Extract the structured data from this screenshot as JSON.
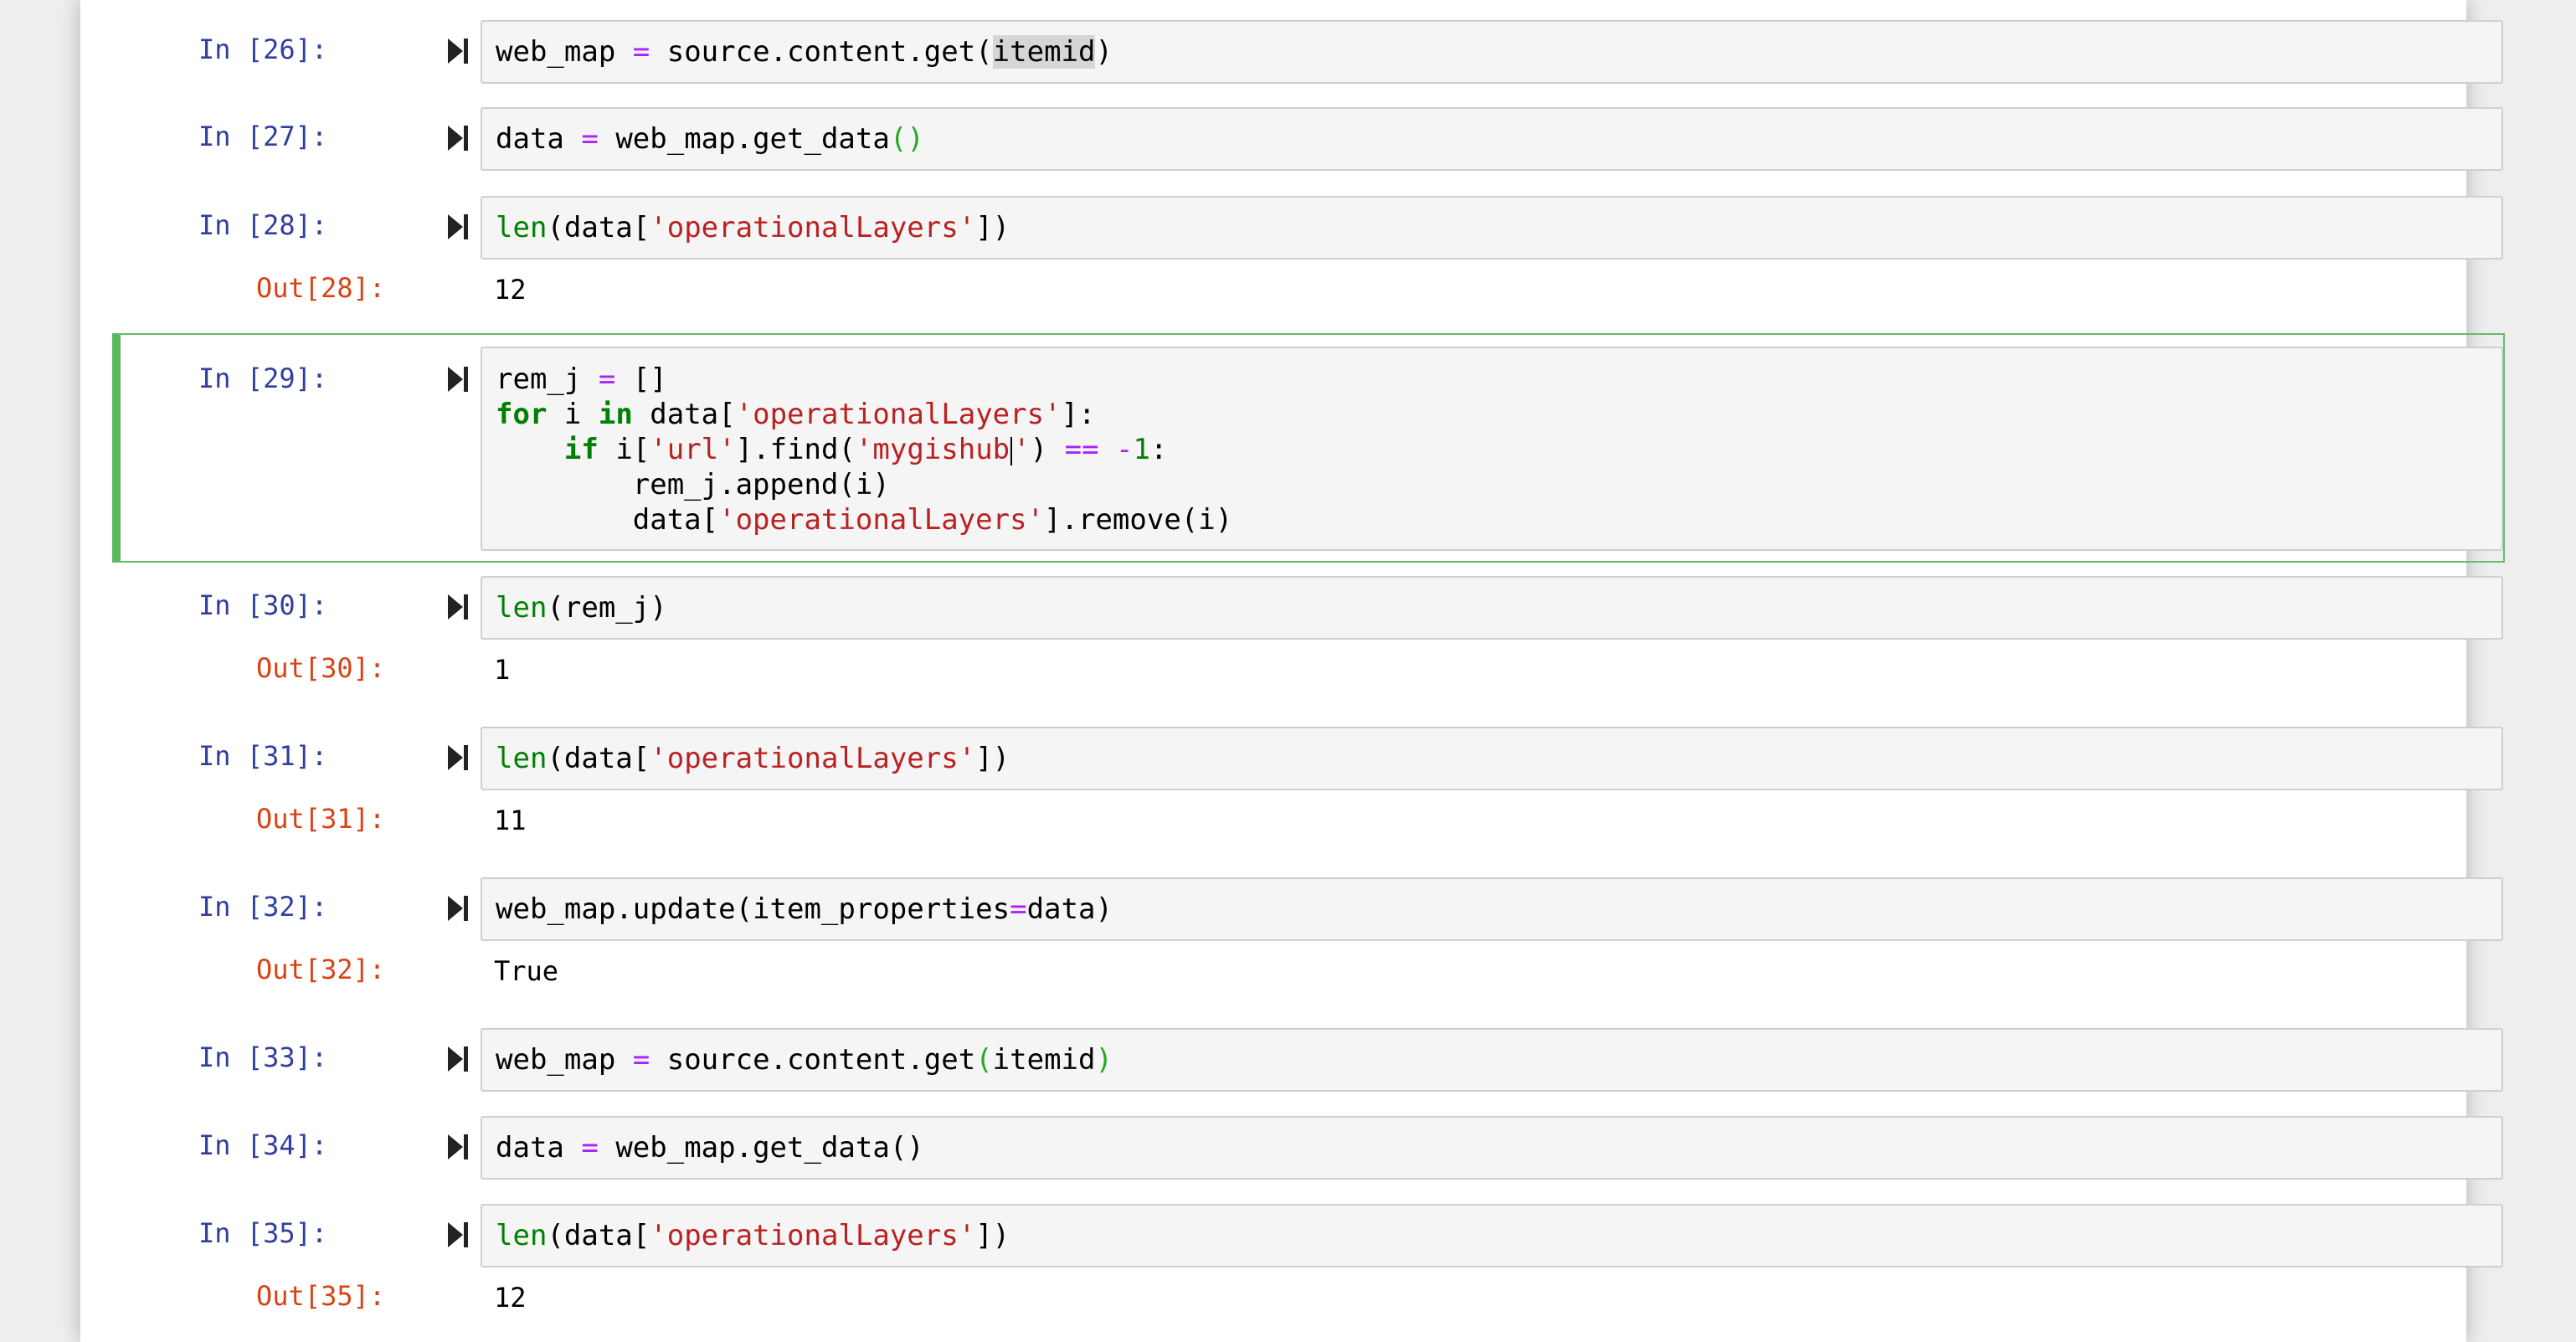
{
  "notebook": {
    "cells": [
      {
        "prompt": "In [26]:",
        "code": "web_map = source.content.get(itemid)",
        "out_prompt": "",
        "output": ""
      },
      {
        "prompt": "In [27]:",
        "code": "data = web_map.get_data()",
        "out_prompt": "",
        "output": ""
      },
      {
        "prompt": "In [28]:",
        "code": "len(data['operationalLayers'])",
        "out_prompt": "Out[28]:",
        "output": "12"
      },
      {
        "prompt": "In [29]:",
        "code_lines": [
          "rem_j = []",
          "for i in data['operationalLayers']:",
          "    if i['url'].find('mygishub') == -1:",
          "        rem_j.append(i)",
          "        data['operationalLayers'].remove(i)"
        ],
        "out_prompt": "",
        "output": ""
      },
      {
        "prompt": "In [30]:",
        "code": "len(rem_j)",
        "out_prompt": "Out[30]:",
        "output": "1"
      },
      {
        "prompt": "In [31]:",
        "code": "len(data['operationalLayers'])",
        "out_prompt": "Out[31]:",
        "output": "11"
      },
      {
        "prompt": "In [32]:",
        "code": "web_map.update(item_properties=data)",
        "out_prompt": "Out[32]:",
        "output": "True"
      },
      {
        "prompt": "In [33]:",
        "code": "web_map = source.content.get(itemid)",
        "out_prompt": "",
        "output": ""
      },
      {
        "prompt": "In [34]:",
        "code": "data = web_map.get_data()",
        "out_prompt": "",
        "output": ""
      },
      {
        "prompt": "In [35]:",
        "code": "len(data['operationalLayers'])",
        "out_prompt": "Out[35]:",
        "output": "12"
      }
    ]
  },
  "colors": {
    "prompt_in": "#303f9f",
    "prompt_out": "#d84315",
    "selected_border": "#5cb85c",
    "code_bg": "#f5f5f5"
  },
  "icons": {
    "run": "run-cell-icon"
  }
}
